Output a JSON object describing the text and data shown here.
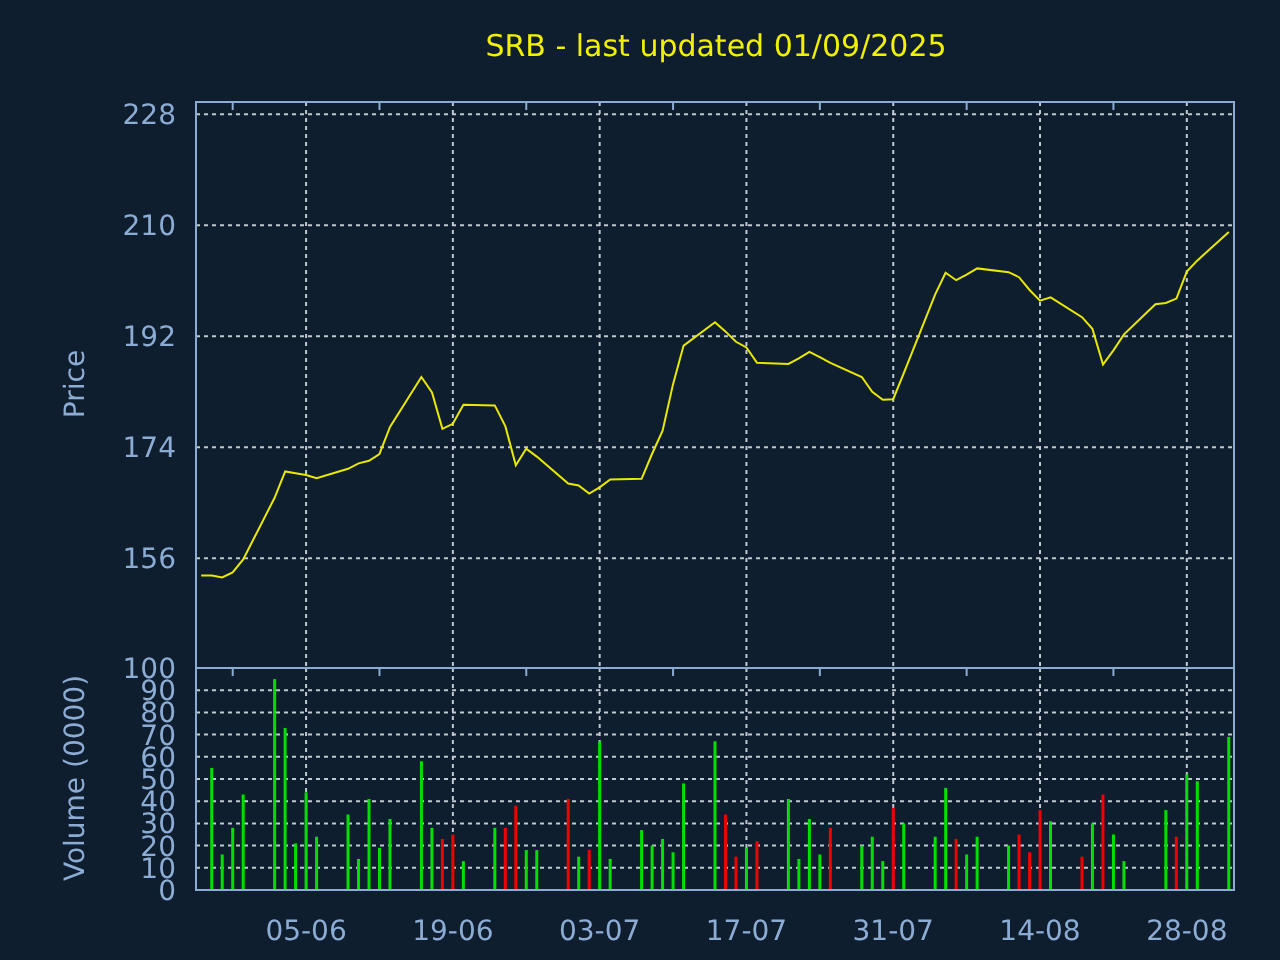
{
  "title": "SRB - last updated 01/09/2025",
  "price_chart": {
    "chart_data": {
      "type": "line",
      "ylabel": "Price",
      "categories": [
        null,
        null,
        null,
        null,
        null,
        null,
        null,
        null,
        null,
        null,
        null,
        null,
        null,
        null,
        null,
        null,
        null,
        null,
        null,
        null,
        null,
        null,
        null,
        null,
        null,
        null,
        null,
        null,
        null,
        null,
        null,
        null,
        null,
        null,
        null,
        null,
        null,
        null,
        null,
        null,
        null,
        null,
        null,
        null,
        null,
        null,
        null,
        null,
        null,
        null,
        null,
        null,
        null,
        null,
        null,
        null,
        null,
        null,
        null,
        null,
        null,
        null,
        null,
        null,
        null,
        null,
        null,
        null,
        null,
        null,
        null,
        null,
        null,
        null,
        null,
        null,
        null,
        null,
        null,
        null,
        null,
        null,
        null,
        null,
        null,
        null,
        null,
        null,
        null,
        null,
        null,
        null,
        null,
        null,
        null,
        null,
        null,
        null,
        null
      ],
      "series": [
        {
          "color": "#e8e800",
          "values": [
            153.2,
            153.2,
            152.9,
            153.7,
            155.8,
            null,
            null,
            165.8,
            170.1,
            169.8,
            169.5,
            169.0,
            null,
            null,
            170.5,
            171.4,
            171.8,
            172.9,
            177.3,
            null,
            null,
            185.4,
            182.9,
            177.0,
            177.8,
            180.9,
            null,
            null,
            180.8,
            177.4,
            171.1,
            173.8,
            172.5,
            null,
            null,
            168.1,
            167.8,
            166.5,
            167.5,
            168.8,
            null,
            null,
            168.9,
            172.9,
            176.7,
            184.2,
            190.5,
            null,
            null,
            194.3,
            192.8,
            191.1,
            190.2,
            187.7,
            null,
            null,
            187.5,
            188.4,
            189.5,
            188.6,
            187.7,
            null,
            null,
            185.4,
            183.0,
            181.7,
            181.8,
            186.0,
            null,
            null,
            198.8,
            202.3,
            201.1,
            202.0,
            203.0,
            null,
            null,
            202.4,
            201.6,
            199.5,
            197.8,
            198.3,
            null,
            null,
            195.1,
            193.2,
            187.4,
            189.7,
            192.3,
            null,
            null,
            197.2,
            197.4,
            198.1,
            202.5,
            204.3,
            null,
            null,
            208.9
          ]
        }
      ],
      "grid": true,
      "ylim": [
        138.2,
        230
      ],
      "yticks": [
        156,
        174,
        192,
        210,
        228
      ]
    }
  },
  "volume_chart": {
    "chart_data": {
      "type": "bar",
      "ylabel": "Volume (0000)",
      "categories": [
        null,
        null,
        null,
        null,
        null,
        null,
        null,
        null,
        null,
        null,
        "05-06",
        null,
        null,
        null,
        null,
        null,
        null,
        null,
        null,
        null,
        null,
        null,
        null,
        null,
        "19-06",
        null,
        null,
        null,
        null,
        null,
        null,
        null,
        null,
        null,
        null,
        null,
        null,
        null,
        "03-07",
        null,
        null,
        null,
        null,
        null,
        null,
        null,
        null,
        null,
        null,
        null,
        null,
        null,
        "17-07",
        null,
        null,
        null,
        null,
        null,
        null,
        null,
        null,
        null,
        null,
        null,
        null,
        null,
        "31-07",
        null,
        null,
        null,
        null,
        null,
        null,
        null,
        null,
        null,
        null,
        null,
        null,
        null,
        "14-08",
        null,
        null,
        null,
        null,
        null,
        null,
        null,
        null,
        null,
        null,
        null,
        null,
        null,
        "28-08",
        null,
        null,
        null,
        null
      ],
      "series": [
        {
          "color": "#00e000",
          "values": [
            null,
            55,
            16,
            28,
            43,
            null,
            null,
            95,
            73,
            21,
            44,
            24,
            null,
            null,
            34,
            14,
            41,
            19,
            32,
            null,
            null,
            58,
            28,
            null,
            null,
            13,
            null,
            null,
            28,
            null,
            null,
            18,
            18,
            null,
            null,
            null,
            15,
            null,
            67,
            14,
            null,
            null,
            27,
            20,
            23,
            17,
            48,
            null,
            null,
            67,
            null,
            null,
            19,
            null,
            null,
            null,
            41,
            14,
            32,
            16,
            null,
            null,
            null,
            20,
            24,
            13,
            null,
            30,
            null,
            null,
            24,
            46,
            null,
            16,
            24,
            null,
            null,
            20,
            null,
            null,
            null,
            31,
            null,
            null,
            null,
            30,
            null,
            25,
            13,
            null,
            null,
            null,
            36,
            null,
            52,
            49,
            null,
            null,
            69
          ]
        },
        {
          "color": "#f00000",
          "values": [
            null,
            null,
            null,
            null,
            null,
            null,
            null,
            null,
            null,
            null,
            null,
            null,
            null,
            null,
            null,
            null,
            null,
            null,
            null,
            null,
            null,
            null,
            null,
            23,
            25,
            null,
            null,
            null,
            null,
            28,
            38,
            null,
            null,
            null,
            null,
            41,
            null,
            18,
            null,
            null,
            null,
            null,
            null,
            null,
            null,
            null,
            null,
            null,
            null,
            null,
            34,
            15,
            null,
            22,
            null,
            null,
            null,
            null,
            null,
            null,
            28,
            null,
            null,
            null,
            null,
            null,
            37,
            null,
            null,
            null,
            null,
            null,
            23,
            null,
            null,
            null,
            null,
            null,
            25,
            17,
            36,
            null,
            null,
            null,
            15,
            null,
            43,
            null,
            null,
            null,
            null,
            null,
            null,
            24,
            null,
            null,
            null,
            null,
            null
          ]
        }
      ],
      "grid": true,
      "ylim": [
        0,
        100
      ],
      "yticks": [
        0,
        10,
        20,
        30,
        40,
        50,
        60,
        70,
        80,
        90,
        100
      ]
    }
  }
}
